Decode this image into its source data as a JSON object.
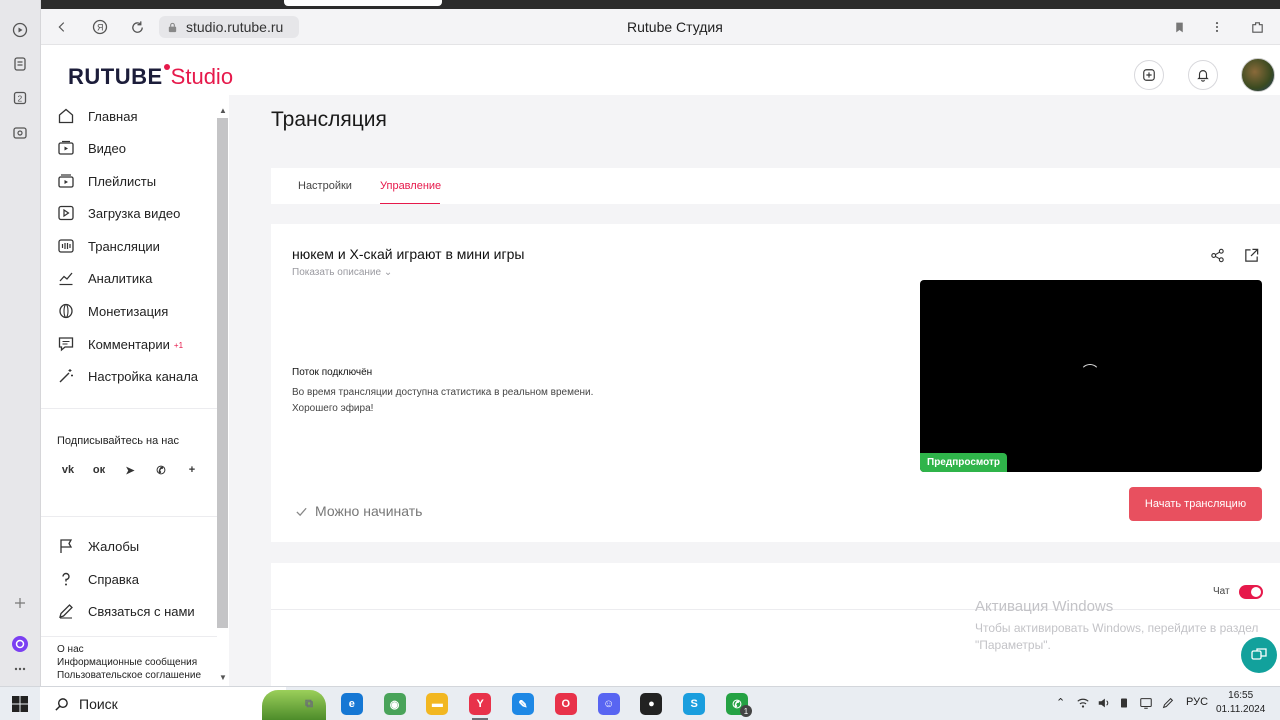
{
  "browser": {
    "url": "studio.rutube.ru",
    "page_title": "Rutube Студия",
    "rail_items": [
      "play-circle-icon",
      "notes-icon",
      "badge-2-icon",
      "media-icon"
    ],
    "rail_number": "2"
  },
  "header": {
    "logo_main": "RUTUBE",
    "logo_sub": "Studio",
    "brand_color": "#e6194b"
  },
  "sidebar": {
    "items": [
      {
        "label": "Главная",
        "icon": "home-icon"
      },
      {
        "label": "Видео",
        "icon": "video-icon"
      },
      {
        "label": "Плейлисты",
        "icon": "playlist-icon"
      },
      {
        "label": "Загрузка видео",
        "icon": "upload-icon"
      },
      {
        "label": "Трансляции",
        "icon": "broadcast-icon"
      },
      {
        "label": "Аналитика",
        "icon": "analytics-icon"
      },
      {
        "label": "Монетизация",
        "icon": "monetization-icon"
      },
      {
        "label": "Комментарии",
        "icon": "comments-icon",
        "badge": "+1"
      },
      {
        "label": "Настройка канала",
        "icon": "wand-icon"
      }
    ],
    "subscribe_title": "Подписывайтесь на нас",
    "socials": [
      "vk-icon",
      "ok-icon",
      "telegram-icon",
      "viber-icon",
      "plus-icon"
    ],
    "social_glyphs": [
      "vk",
      "ок",
      "➤",
      "✆",
      "+"
    ],
    "bottom_items": [
      {
        "label": "Жалобы",
        "icon": "flag-icon"
      },
      {
        "label": "Справка",
        "icon": "help-icon"
      },
      {
        "label": "Связаться с нами",
        "icon": "pen-icon"
      }
    ],
    "footer_links": [
      "О нас",
      "Информационные сообщения",
      "Пользовательское соглашение"
    ]
  },
  "main": {
    "title": "Трансляция",
    "tabs": [
      {
        "label": "Настройки",
        "active": false
      },
      {
        "label": "Управление",
        "active": true
      }
    ],
    "stream": {
      "title": "нюкем и X-скай играют в мини игры",
      "show_description": "Показать описание",
      "status_title": "Поток подключён",
      "status_line1": "Во время трансляции доступна статистика в реальном времени.",
      "status_line2": "Хорошего эфира!",
      "preview_label": "Предпросмотр",
      "ready_text": "Можно начинать",
      "start_button": "Начать трансляцию"
    },
    "chat_label": "Чат",
    "chat_enabled": true
  },
  "watermark": {
    "line1": "Активация Windows",
    "line2": "Чтобы активировать Windows, перейдите в раздел",
    "line3": "\"Параметры\"."
  },
  "taskbar": {
    "search_placeholder": "Поиск",
    "apps": [
      "task-view-icon",
      "edge-icon",
      "maps-icon",
      "explorer-icon",
      "yandex-browser-icon",
      "paint-icon",
      "opera-icon",
      "discord-icon",
      "obs-icon",
      "skype-icon",
      "whatsapp-icon"
    ],
    "app_glyphs": [
      "⧉",
      "e",
      "◉",
      "▬",
      "Y",
      "✎",
      "O",
      "☺",
      "●",
      "S",
      "✆"
    ],
    "app_colors": [
      "#6b6f76",
      "#1577d4",
      "#49a35a",
      "#f2b721",
      "#e8324a",
      "#1e88e5",
      "#e8324a",
      "#5865f2",
      "#222222",
      "#1a9ede",
      "#25a244"
    ],
    "whatsapp_badge": "1",
    "language": "РУС",
    "time": "16:55",
    "date": "01.11.2024"
  }
}
